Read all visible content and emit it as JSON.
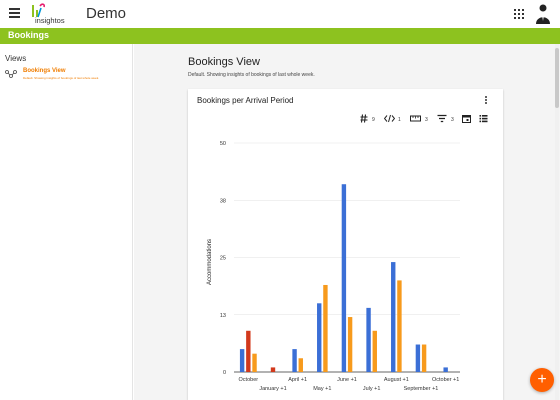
{
  "app": {
    "title": "Demo",
    "logo_text": "insightos",
    "menu_icon": "hamburger-icon",
    "apps_icon": "apps-grid-icon",
    "avatar_icon": "user-avatar-icon"
  },
  "section_bar": {
    "label": "Bookings",
    "color": "#8dc21f"
  },
  "sidebar": {
    "heading": "Views",
    "items": [
      {
        "label": "Bookings View",
        "description": "Default. Showing insights of bookings of last whole week.",
        "icon": "share-nodes-icon",
        "active": true
      }
    ]
  },
  "main": {
    "title": "Bookings View",
    "subtitle": "Default. Showing insights of bookings of last whole week."
  },
  "card": {
    "title": "Bookings per Arrival Period",
    "toolbar": [
      {
        "icon": "hash-icon",
        "value": "9"
      },
      {
        "icon": "code-arrows-icon",
        "value": "1"
      },
      {
        "icon": "ruler-icon",
        "value": "3"
      },
      {
        "icon": "filter-icon",
        "value": "3"
      },
      {
        "icon": "calendar-icon",
        "value": ""
      },
      {
        "icon": "list-icon",
        "value": ""
      }
    ]
  },
  "fab": {
    "label": "+",
    "color": "#ff5f00"
  },
  "colors": {
    "accent": "#f07d00",
    "blue": "#3b6fd6",
    "orange": "#f79a1c",
    "red": "#d2391c"
  },
  "chart_data": {
    "type": "bar",
    "ylabel": "Accommodations",
    "yticks": [
      "50",
      "38",
      "25",
      "13",
      "0"
    ],
    "ylim": [
      0,
      50
    ],
    "grid": true,
    "categories": [
      "October",
      "January +1",
      "April +1",
      "May +1",
      "June +1",
      "July +1",
      "August +1",
      "September +1",
      "October +1"
    ],
    "series": [
      {
        "color": "#3b6fd6",
        "values": [
          5,
          0,
          5,
          15,
          41,
          14,
          24,
          6,
          1
        ]
      },
      {
        "color": "#d2391c",
        "values": [
          9,
          1,
          0,
          0,
          0,
          0,
          0,
          0,
          0
        ]
      },
      {
        "color": "#f79a1c",
        "values": [
          4,
          0,
          3,
          19,
          12,
          9,
          20,
          6,
          0
        ]
      }
    ]
  }
}
